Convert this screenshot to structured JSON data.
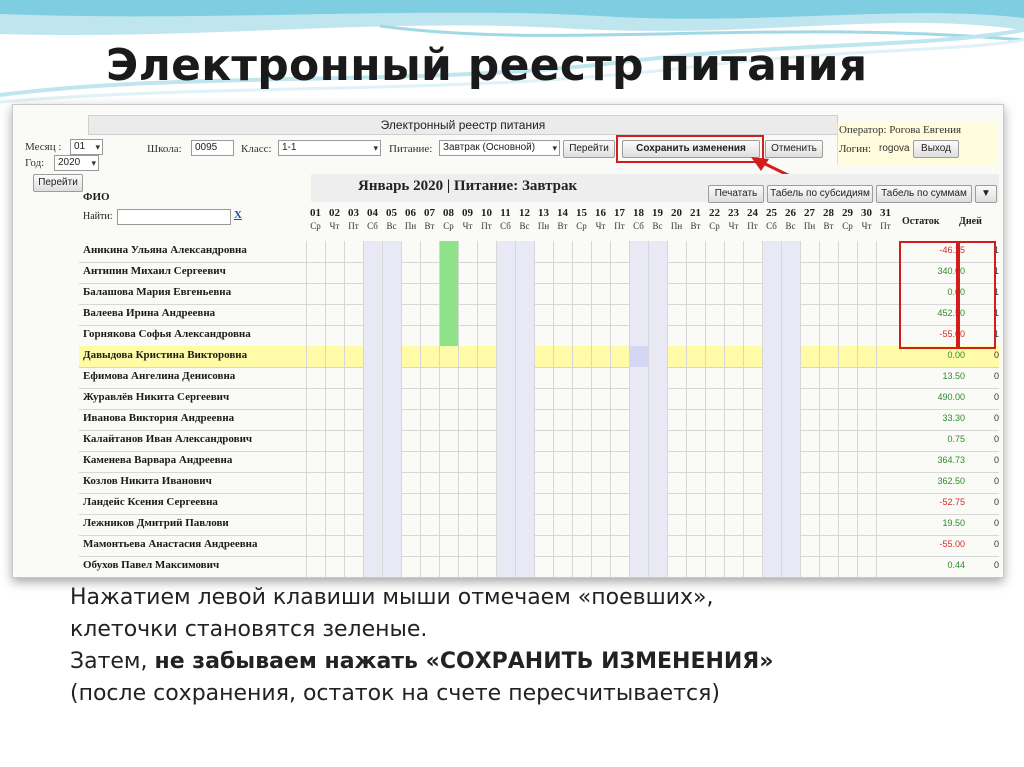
{
  "slide": {
    "title": "Электронный реестр питания",
    "caption": {
      "line1": "Нажатием левой клавиши мыши отмечаем «поевших»,",
      "line2": "клеточки становятся зеленые.",
      "line3_prefix": "Затем, ",
      "line3_bold": "не забываем нажать «СОХРАНИТЬ ИЗМЕНЕНИЯ»",
      "line4": "(после сохранения, остаток на счете пересчитывается)"
    }
  },
  "app": {
    "window_title": "Электронный реестр питания",
    "month_label": "Месяц :",
    "month_value": "01",
    "year_label": "Год:",
    "year_value": "2020",
    "go_left_label": "Перейти",
    "school_label": "Школа:",
    "school_value": "0095",
    "class_label": "Класс:",
    "class_value": "1-1",
    "meal_label": "Питание:",
    "meal_value": "Завтрак (Основной)",
    "go_label": "Перейти",
    "save_label": "Сохранить изменения",
    "cancel_label": "Отменить",
    "operator": "Оператор: Рогова Евгения",
    "login_label": "Логин:",
    "login_value": "rogova",
    "logout_label": "Выход",
    "grid_title": "Январь 2020 | Питание: Завтрак",
    "print_label": "Печатать",
    "tabel_subsidy_label": "Табель по субсидиям",
    "tabel_sum_label": "Табель по суммам",
    "more_label": "▼",
    "fio_header": "ФИО",
    "find_label": "Найти:",
    "clear_label": "X",
    "balance_header": "Остаток",
    "days_header": "Дней"
  },
  "colors": {
    "accent_red": "#d21d1d",
    "eaten_green": "#8ee28a",
    "weekend": "#e9e9f6",
    "highlight": "#fffba6",
    "positive": "#2e8b2e",
    "negative": "#d22b2b"
  },
  "days": [
    {
      "num": "01",
      "dow": "Ср"
    },
    {
      "num": "02",
      "dow": "Чт"
    },
    {
      "num": "03",
      "dow": "Пт"
    },
    {
      "num": "04",
      "dow": "Сб"
    },
    {
      "num": "05",
      "dow": "Вс"
    },
    {
      "num": "06",
      "dow": "Пн"
    },
    {
      "num": "07",
      "dow": "Вт"
    },
    {
      "num": "08",
      "dow": "Ср"
    },
    {
      "num": "09",
      "dow": "Чт"
    },
    {
      "num": "10",
      "dow": "Пт"
    },
    {
      "num": "11",
      "dow": "Сб"
    },
    {
      "num": "12",
      "dow": "Вс"
    },
    {
      "num": "13",
      "dow": "Пн"
    },
    {
      "num": "14",
      "dow": "Вт"
    },
    {
      "num": "15",
      "dow": "Ср"
    },
    {
      "num": "16",
      "dow": "Чт"
    },
    {
      "num": "17",
      "dow": "Пт"
    },
    {
      "num": "18",
      "dow": "Сб"
    },
    {
      "num": "19",
      "dow": "Вс"
    },
    {
      "num": "20",
      "dow": "Пн"
    },
    {
      "num": "21",
      "dow": "Вт"
    },
    {
      "num": "22",
      "dow": "Ср"
    },
    {
      "num": "23",
      "dow": "Чт"
    },
    {
      "num": "24",
      "dow": "Пт"
    },
    {
      "num": "25",
      "dow": "Сб"
    },
    {
      "num": "26",
      "dow": "Вс"
    },
    {
      "num": "27",
      "dow": "Пн"
    },
    {
      "num": "28",
      "dow": "Вт"
    },
    {
      "num": "29",
      "dow": "Ср"
    },
    {
      "num": "30",
      "dow": "Чт"
    },
    {
      "num": "31",
      "dow": "Пт"
    }
  ],
  "students": [
    {
      "name": "Аникина Ульяна Александровна",
      "balance": "-46.25",
      "days": "1",
      "eaten": true
    },
    {
      "name": "Антипин Михаил Сергеевич",
      "balance": "340.00",
      "days": "1",
      "eaten": true
    },
    {
      "name": "Балашова Мария Евгеньевна",
      "balance": "0.00",
      "days": "1",
      "eaten": true
    },
    {
      "name": "Валеева Ирина Андреевна",
      "balance": "452.50",
      "days": "1",
      "eaten": true
    },
    {
      "name": "Горнякова Софья Александровна",
      "balance": "-55.00",
      "days": "1",
      "eaten": true
    },
    {
      "name": "Давыдова Кристина Викторовна",
      "balance": "0.00",
      "days": "0",
      "eaten": false,
      "highlight": true
    },
    {
      "name": "Ефимова Ангелина Денисовна",
      "balance": "13.50",
      "days": "0",
      "eaten": false
    },
    {
      "name": "Журавлёв Никита Сергеевич",
      "balance": "490.00",
      "days": "0",
      "eaten": false
    },
    {
      "name": "Иванова Виктория Андреевна",
      "balance": "33.30",
      "days": "0",
      "eaten": false
    },
    {
      "name": "Калайтанов Иван Александрович",
      "balance": "0.75",
      "days": "0",
      "eaten": false
    },
    {
      "name": "Каменева Варвара Андреевна",
      "balance": "364.73",
      "days": "0",
      "eaten": false
    },
    {
      "name": "Козлов Никита Иванович",
      "balance": "362.50",
      "days": "0",
      "eaten": false
    },
    {
      "name": "Ландейс Ксения Сергеевна",
      "balance": "-52.75",
      "days": "0",
      "eaten": false
    },
    {
      "name": "Лежников Дмитрий Павлови",
      "balance": "19.50",
      "days": "0",
      "eaten": false
    },
    {
      "name": "Мамонтьева Анастасия Андреевна",
      "balance": "-55.00",
      "days": "0",
      "eaten": false
    },
    {
      "name": "Обухов Павел Максимович",
      "balance": "0.44",
      "days": "0",
      "eaten": false
    }
  ]
}
